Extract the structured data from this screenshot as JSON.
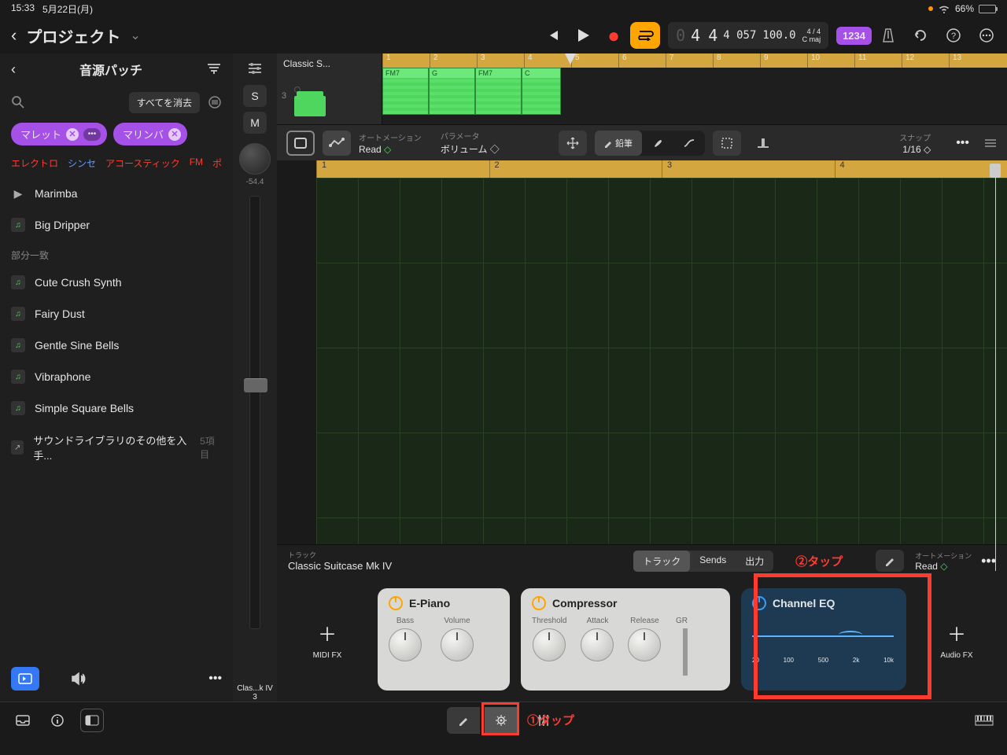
{
  "status": {
    "time": "15:33",
    "date": "5月22日(月)",
    "battery": "66%"
  },
  "title": {
    "project": "プロジェクト"
  },
  "transport": {
    "bars_beats": "4 4",
    "subdiv": "4 057",
    "tempo": "100.0",
    "sig": "4 / 4",
    "key": "C maj",
    "view": "1234"
  },
  "sidebar": {
    "title": "音源パッチ",
    "clear": "すべてを消去",
    "tags": [
      {
        "label": "マレット"
      },
      {
        "label": "マリンバ"
      }
    ],
    "categories": [
      "エレクトロ",
      "シンセ",
      "アコースティック",
      "FM",
      "ポ"
    ],
    "items_main": [
      {
        "label": "Marimba",
        "playing": true
      },
      {
        "label": "Big Dripper"
      }
    ],
    "section": "部分一致",
    "items_partial": [
      {
        "label": "Cute Crush Synth"
      },
      {
        "label": "Fairy Dust"
      },
      {
        "label": "Gentle Sine Bells"
      },
      {
        "label": "Vibraphone"
      },
      {
        "label": "Simple Square Bells"
      }
    ],
    "library": {
      "label": "サウンドライブラリのその他を入手...",
      "count": "5項目"
    }
  },
  "track_strip": {
    "solo": "S",
    "mute": "M",
    "db": "-54.4",
    "name_short": "Clas...k IV",
    "num": "3"
  },
  "arrange": {
    "track_name": "Classic S...",
    "track_num": "3",
    "ruler_bars": [
      "1",
      "2",
      "3",
      "4",
      "5",
      "6",
      "7",
      "8",
      "9",
      "10",
      "11",
      "12",
      "13"
    ],
    "regions": [
      {
        "chord": "FM7"
      },
      {
        "chord": "G"
      },
      {
        "chord": "FM7"
      },
      {
        "chord": "C"
      }
    ]
  },
  "editor_toolbar": {
    "automation": {
      "label": "オートメーション",
      "value": "Read"
    },
    "param": {
      "label": "パラメータ",
      "value": "ボリューム"
    },
    "tool": "鉛筆",
    "snap": {
      "label": "スナップ",
      "value": "1/16"
    }
  },
  "piano_roll": {
    "bars": [
      "1",
      "2",
      "3",
      "4"
    ]
  },
  "mixer": {
    "track_label": "トラック",
    "track_name": "Classic Suitcase Mk IV",
    "seg": [
      "トラック",
      "Sends",
      "出力"
    ],
    "annot2": "②タップ",
    "automation": {
      "label": "オートメーション",
      "value": "Read"
    },
    "midi_fx": "MIDI FX",
    "audio_fx": "Audio FX",
    "plugins": {
      "epiano": {
        "name": "E-Piano",
        "k1": "Bass",
        "k2": "Volume"
      },
      "comp": {
        "name": "Compressor",
        "k1": "Threshold",
        "k2": "Attack",
        "k3": "Release",
        "gr": "GR"
      },
      "eq": {
        "name": "Channel EQ",
        "ticks": [
          "20",
          "100",
          "500",
          "2k",
          "10k"
        ]
      }
    }
  },
  "bottom": {
    "annot1": "①タップ"
  }
}
